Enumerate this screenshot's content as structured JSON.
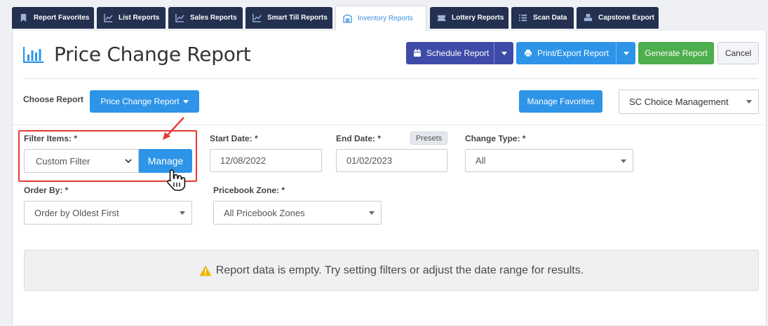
{
  "tabs": [
    {
      "label": "Report Favorites",
      "icon": "bookmark-icon"
    },
    {
      "label": "List Reports",
      "icon": "chart-line-icon"
    },
    {
      "label": "Sales Reports",
      "icon": "chart-line-icon"
    },
    {
      "label": "Smart Till Reports",
      "icon": "chart-line-icon"
    },
    {
      "label": "Inventory Reports",
      "icon": "warehouse-icon",
      "active": true
    },
    {
      "label": "Lottery Reports",
      "icon": "ticket-icon"
    },
    {
      "label": "Scan Data",
      "icon": "list-icon"
    },
    {
      "label": "Capstone Export",
      "icon": "cubes-icon"
    }
  ],
  "header": {
    "title": "Price Change Report",
    "schedule_label": "Schedule Report",
    "print_label": "Print/Export Report",
    "generate_label": "Generate Report",
    "cancel_label": "Cancel"
  },
  "choose": {
    "label": "Choose Report",
    "report_button": "Price Change Report",
    "favorites_button": "Manage Favorites",
    "account_select": "SC Choice Management"
  },
  "filters": {
    "filter_items_label": "Filter Items: *",
    "filter_items_value": "Custom Filter",
    "manage_button": "Manage",
    "start_label": "Start Date: *",
    "start_value": "12/08/2022",
    "end_label": "End Date: *",
    "end_value": "01/02/2023",
    "presets_label": "Presets",
    "change_type_label": "Change Type: *",
    "change_type_value": "All",
    "order_by_label": "Order By: *",
    "order_by_value": "Order by Oldest First",
    "zone_label": "Pricebook Zone: *",
    "zone_value": "All Pricebook Zones"
  },
  "empty_message": "Report data is empty. Try setting filters or adjust the date range for results.",
  "colors": {
    "tab_dark": "#23304f",
    "tab_active_text": "#3a8fe0",
    "navy_button": "#3f4ba8",
    "blue_button": "#2d94e8",
    "green_button": "#4cae4c",
    "highlight_red": "#e53935",
    "warning_yellow": "#f0b400"
  }
}
